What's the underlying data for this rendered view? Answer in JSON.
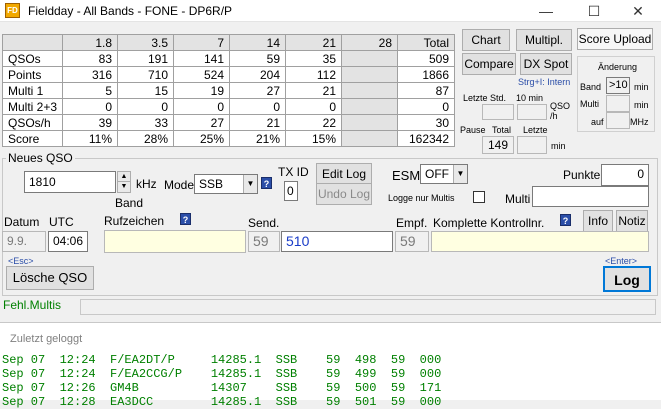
{
  "window": {
    "title": "Fieldday - All Bands - FONE  - DP6R/P",
    "app_icon_text": "FD"
  },
  "stats": {
    "columns": [
      "",
      "1.8",
      "3.5",
      "7",
      "14",
      "21",
      "28",
      "Total"
    ],
    "rows": [
      {
        "label": "QSOs",
        "values": [
          "83",
          "191",
          "141",
          "59",
          "35",
          "",
          "509"
        ]
      },
      {
        "label": "Points",
        "values": [
          "316",
          "710",
          "524",
          "204",
          "112",
          "",
          "1866"
        ]
      },
      {
        "label": "Multi 1",
        "values": [
          "5",
          "15",
          "19",
          "27",
          "21",
          "",
          "87"
        ]
      },
      {
        "label": "Multi 2+3",
        "values": [
          "0",
          "0",
          "0",
          "0",
          "0",
          "",
          "0"
        ]
      },
      {
        "label": "QSOs/h",
        "values": [
          "39",
          "33",
          "27",
          "21",
          "22",
          "",
          "30"
        ]
      },
      {
        "label": "Score",
        "values": [
          "11%",
          "28%",
          "25%",
          "21%",
          "15%",
          "",
          "162342"
        ]
      }
    ]
  },
  "right_buttons": {
    "chart": "Chart",
    "multipl": "Multipl.",
    "score_upload": "Score Upload",
    "compare": "Compare",
    "dx_spot": "DX Spot",
    "strg_hint": "Strg+I: Intern"
  },
  "change_panel": {
    "title": "Änderung",
    "band_label": "Band",
    "band_value": ">10",
    "band_unit": "min",
    "multi_label": "Multi",
    "multi_unit": "min",
    "auf_label": "auf",
    "auf_unit": "MHz"
  },
  "rate_panel": {
    "letzte_std": "Letzte Std.",
    "ten_min": "10 min",
    "qso_h": "QSO /h",
    "pause": "Pause",
    "total": "Total",
    "letzte": "Letzte",
    "total_value": "149",
    "min": "min"
  },
  "new_qso": {
    "group_title": "Neues QSO",
    "freq_value": "1810",
    "khz": "kHz",
    "band": "Band",
    "mode_label": "Mode",
    "mode_value": "SSB",
    "txid_label": "TX ID",
    "txid_value": "0",
    "edit_log": "Edit Log",
    "undo_log": "Undo Log",
    "esm_label": "ESM",
    "esm_value": "OFF",
    "logge_multis": "Logge nur Multis",
    "multi_label": "Multi",
    "punkte_label": "Punkte",
    "punkte_value": "0",
    "datum_label": "Datum",
    "datum_value": "9.9.",
    "utc_label": "UTC",
    "utc_value": "04:06",
    "rufzeichen_label": "Rufzeichen",
    "send_label": "Send.",
    "send_rst": "59",
    "send_nr": "510",
    "empf_label": "Empf.",
    "empf_rst": "59",
    "kontroll_label": "Komplette Kontrollnr.",
    "info": "Info",
    "notiz": "Notiz",
    "esc_hint": "<Esc>",
    "enter_hint": "<Enter>",
    "loesche": "Lösche QSO",
    "log": "Log",
    "help_q": "?"
  },
  "status": {
    "fehl_multis": "Fehl.Multis"
  },
  "recent": {
    "title": "Zuletzt geloggt",
    "lines": [
      "Sep 07  12:24  F/EA2DT/P     14285.1  SSB    59  498  59  000",
      "Sep 07  12:24  F/EA2CCG/P    14285.1  SSB    59  499  59  000",
      "Sep 07  12:26  GM4B          14307    SSB    59  500  59  171",
      "Sep 07  12:28  EA3DCC        14285.1  SSB    59  501  59  000"
    ]
  }
}
